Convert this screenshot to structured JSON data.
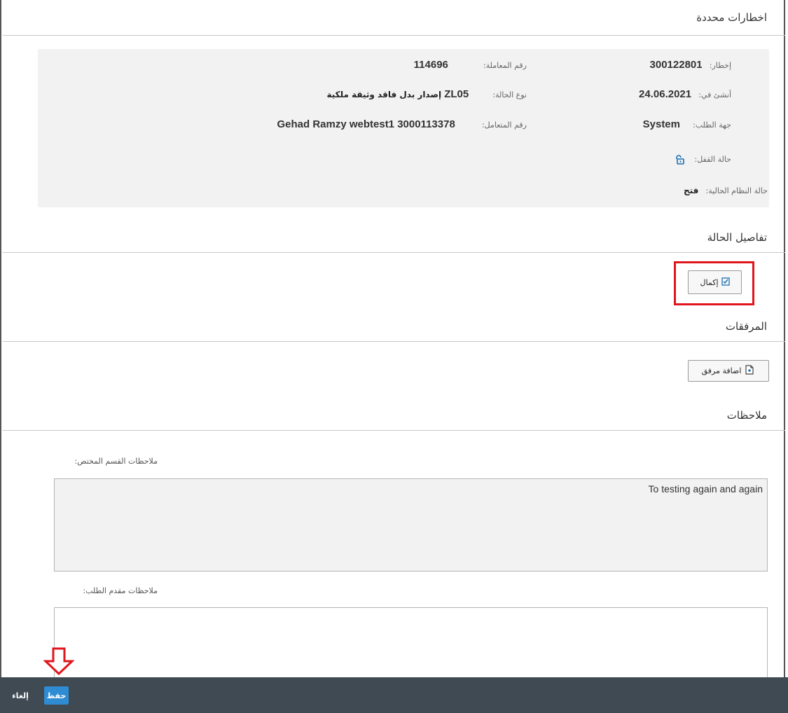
{
  "sections": {
    "notification": "اخطارات محددة",
    "case_details": "تفاصيل الحالة",
    "attachments": "المرفقات",
    "notes": "ملاحظات"
  },
  "header": {
    "notification": {
      "label": "إخطار:",
      "value": "300122801"
    },
    "created_on": {
      "label": "أنشئ في:",
      "value": "24.06.2021"
    },
    "requester": {
      "label": "جهة الطلب:",
      "value": "System"
    },
    "lock_status": {
      "label": "حالة القفل:",
      "icon": "unlock-icon"
    },
    "system_status": {
      "label": "حالة النظام الحالية:",
      "value": "فتح"
    },
    "transaction_no": {
      "label": "رقم المعاملة:",
      "value": "114696"
    },
    "case_type": {
      "label": "نوع الحالة:",
      "code": "ZL05",
      "text": "إصدار بدل فاقد وثيقة ملكية"
    },
    "dealer_no": {
      "label": "رقم المتعامل:",
      "value": "Gehad Ramzy webtest1 3000113378"
    }
  },
  "buttons": {
    "complete": "إكمال",
    "add_attachment": "اضافة مرفق",
    "save": "حفظ",
    "cancel": "إلغاء"
  },
  "notes": {
    "department_label": "ملاحظات القسم المختص:",
    "department_value": "To testing again and again",
    "applicant_label": "ملاحظات مقدم الطلب:",
    "applicant_value": ""
  },
  "colors": {
    "highlight": "#e0161d",
    "footer": "#3f4a52",
    "save_button": "#2f8cd3"
  }
}
